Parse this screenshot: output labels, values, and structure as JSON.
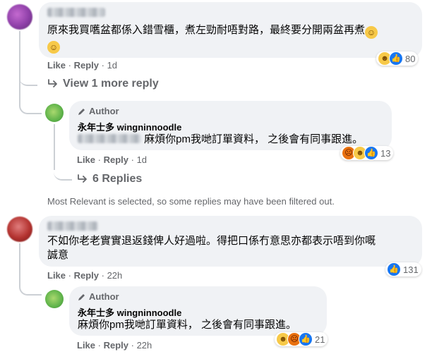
{
  "comment1": {
    "text": "原來我買嚿盆都係入錯雪櫃，煮左勁耐唔對路，最終要分開兩盆再煮",
    "actions": {
      "like": "Like",
      "reply": "Reply",
      "time": "1d"
    },
    "reaction_count": "80",
    "view_more": "View 1 more reply"
  },
  "reply1": {
    "author_tag": "Author",
    "author_name": "永年士多 wingninnoodle",
    "text": "麻煩你pm我哋訂單資料， 之後會有同事跟進。",
    "actions": {
      "like": "Like",
      "reply": "Reply",
      "time": "1d"
    },
    "reaction_count": "13",
    "replies_link": "6 Replies"
  },
  "filter_note": "Most Relevant is selected, so some replies may have been filtered out.",
  "comment2": {
    "text_line1": "不如你老老實實退返錢俾人好過啦。得把口係冇意思亦都表示唔到你嘅",
    "text_line2": "誠意",
    "actions": {
      "like": "Like",
      "reply": "Reply",
      "time": "22h"
    },
    "reaction_count": "131"
  },
  "reply2": {
    "author_tag": "Author",
    "author_name": "永年士多 wingninnoodle",
    "text": "麻煩你pm我哋訂單資料， 之後會有同事跟進。",
    "actions": {
      "like": "Like",
      "reply": "Reply",
      "time": "22h"
    },
    "reaction_count": "21"
  },
  "icons": {
    "reply_arrow": "reply-arrow-icon",
    "pencil": "pencil-icon",
    "like": "like-icon",
    "haha": "haha-icon",
    "angry": "angry-icon",
    "thinking": "thinking-emoji-icon"
  },
  "colors": {
    "bubble": "#f0f2f5",
    "secondary_text": "#65676b",
    "like_blue": "#1877f2",
    "thread_line": "#ccd0d5"
  }
}
